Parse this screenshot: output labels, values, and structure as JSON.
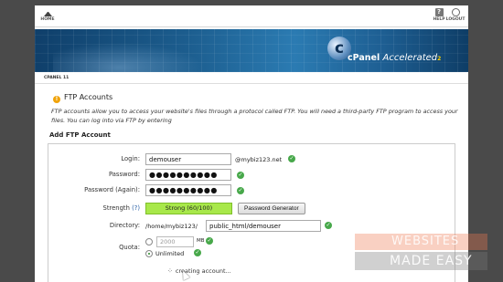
{
  "topnav": {
    "home_label": "HOME",
    "help_label": "HELP",
    "logout_label": "LOGOUT"
  },
  "banner": {
    "logo_letter": "c",
    "brand": "cPanel",
    "tagline": "Accelerated",
    "version_mark": "2"
  },
  "breadcrumb": "CPANEL 11",
  "section": {
    "title": "FTP Accounts",
    "description": "FTP accounts allow you to access your website's files through a protocol called FTP. You will need a third-party FTP program to access your files. You can log into via FTP by entering"
  },
  "form": {
    "title": "Add FTP Account",
    "login_label": "Login:",
    "login_value": "demouser",
    "domain_suffix": "@mybiz123.net",
    "password_label": "Password:",
    "password_value": "●●●●●●●●●●",
    "password_again_label": "Password (Again):",
    "password_again_value": "●●●●●●●●●●",
    "strength_label": "Strength",
    "strength_help": "(?)",
    "strength_text": "Strong (60/100)",
    "generator_button": "Password Generator",
    "directory_label": "Directory:",
    "directory_prefix": "/home/mybiz123/",
    "directory_value": "public_html/demouser",
    "quota_label": "Quota:",
    "quota_value": "2000",
    "quota_unit": "MB",
    "quota_unlimited": "Unlimited",
    "quota_selected": "Unlimited",
    "status_text": "creating account..."
  },
  "watermark": {
    "line1": "WEBSITES",
    "line2": "MADE EASY"
  },
  "colors": {
    "strength_fill": "#a8e84a",
    "check": "#47a84a",
    "link": "#2b62a8"
  }
}
